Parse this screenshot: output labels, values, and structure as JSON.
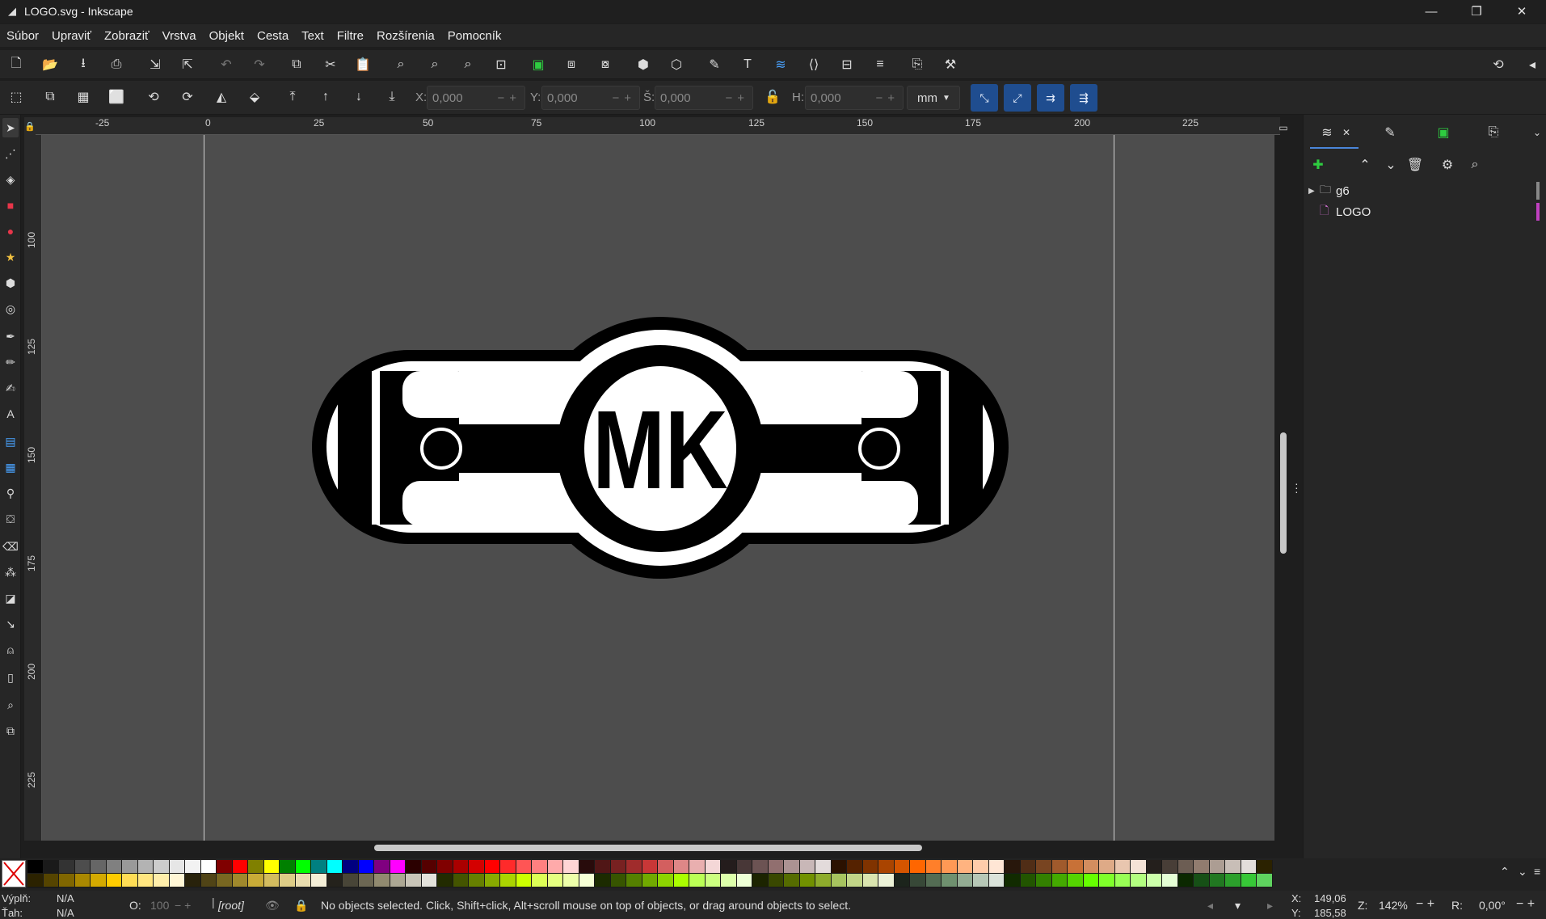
{
  "window": {
    "title": "LOGO.svg - Inkscape",
    "controls": [
      "—",
      "❐",
      "✕"
    ]
  },
  "menu": [
    "Súbor",
    "Upraviť",
    "Zobraziť",
    "Vrstva",
    "Objekt",
    "Cesta",
    "Text",
    "Filtre",
    "Rozšírenia",
    "Pomocník"
  ],
  "controls": {
    "x_label": "X:",
    "x_value": "0,000",
    "y_label": "Y:",
    "y_value": "0,000",
    "w_label": "Š:",
    "w_value": "0,000",
    "h_label": "H:",
    "h_value": "0,000",
    "unit": "mm"
  },
  "rulers": {
    "horizontal": [
      "-25",
      "0",
      "25",
      "50",
      "75",
      "100",
      "125",
      "150",
      "175",
      "200",
      "225"
    ],
    "vertical": [
      "100",
      "125",
      "150",
      "175",
      "200",
      "225"
    ]
  },
  "logo": {
    "text": "MK",
    "colors": {
      "dark": "#000000",
      "light": "#ffffff"
    }
  },
  "layers": {
    "items": [
      {
        "name": "g6",
        "type": "group",
        "color": "#888888"
      },
      {
        "name": "LOGO",
        "type": "layer",
        "color": "#c040c0"
      }
    ]
  },
  "status": {
    "fill_label": "Výplň:",
    "fill_value": "N/A",
    "stroke_label": "Ťah:",
    "stroke_value": "N/A",
    "opacity_label": "O:",
    "opacity_value": "100",
    "layer": "[root]",
    "message": "No objects selected. Click, Shift+click, Alt+scroll mouse on top of objects, or drag around objects to select.",
    "cursor_x_label": "X:",
    "cursor_x": "149,06",
    "cursor_y_label": "Y:",
    "cursor_y": "185,58",
    "zoom_label": "Z:",
    "zoom": "142%",
    "rotation_label": "R:",
    "rotation": "0,00°"
  },
  "palette": {
    "row1": [
      "#000000",
      "#1a1a1a",
      "#333333",
      "#4d4d4d",
      "#666666",
      "#808080",
      "#999999",
      "#b3b3b3",
      "#cccccc",
      "#e6e6e6",
      "#f2f2f2",
      "#ffffff",
      "#800000",
      "#ff0000",
      "#808000",
      "#ffff00",
      "#008000",
      "#00ff00",
      "#008080",
      "#00ffff",
      "#000080",
      "#0000ff",
      "#800080",
      "#ff00ff",
      "#2b0000",
      "#550000",
      "#800000",
      "#aa0000",
      "#d40000",
      "#ff0000",
      "#ff2a2a",
      "#ff5555",
      "#ff8080",
      "#ffaaaa",
      "#ffd5d5",
      "#280b0b",
      "#501616",
      "#782121",
      "#a02c2c",
      "#c83737",
      "#d35f5f",
      "#de8787",
      "#e9afaf",
      "#f4d7d7",
      "#241c1c",
      "#483737",
      "#6c5353",
      "#916f6f",
      "#ac9393",
      "#c8b7b7",
      "#e3dbdb",
      "#2b1100",
      "#552200",
      "#803300",
      "#aa4400",
      "#d45500",
      "#ff6600",
      "#ff7f2a",
      "#ff9955",
      "#ffb380",
      "#ffccaa",
      "#ffe6d5",
      "#28170b",
      "#502d16",
      "#784421",
      "#a05a2c",
      "#c87137",
      "#d38d5f",
      "#deaa87",
      "#e9c6af",
      "#f4e3d7",
      "#241f1c",
      "#483e37",
      "#6c5d53",
      "#917c6f",
      "#ac9d93",
      "#c8beb7",
      "#e3dedb",
      "#2b2200"
    ],
    "row2": [
      "#2b2200",
      "#554400",
      "#806600",
      "#aa8800",
      "#d4aa00",
      "#ffcc00",
      "#ffdd55",
      "#ffe680",
      "#ffeeaa",
      "#fff6d5",
      "#28220b",
      "#504416",
      "#786721",
      "#a0892c",
      "#c8ab37",
      "#d3bc5f",
      "#decd87",
      "#e9ddaf",
      "#f4eed7",
      "#24221c",
      "#484537",
      "#6c6753",
      "#918a6f",
      "#aca793",
      "#c8c4b7",
      "#e3e2db",
      "#222b00",
      "#445500",
      "#668000",
      "#88aa00",
      "#aad400",
      "#ccff00",
      "#ddff55",
      "#e5ff80",
      "#eeffaa",
      "#f6ffd5",
      "#1c2b00",
      "#375500",
      "#558000",
      "#71aa00",
      "#8dd400",
      "#aaff00",
      "#bbff55",
      "#ccff80",
      "#ddffaa",
      "#eeffd5",
      "#1c2400",
      "#394800",
      "#556c00",
      "#719100",
      "#8eac2c",
      "#a7c45f",
      "#c1d587",
      "#dae5af",
      "#ecf2d7",
      "#1c241c",
      "#374837",
      "#536c53",
      "#6f916f",
      "#93ac93",
      "#b7c8b7",
      "#dbe3db",
      "#112b00",
      "#225500",
      "#338000",
      "#44aa00",
      "#55d400",
      "#66ff00",
      "#7fff2a",
      "#99ff55",
      "#b3ff80",
      "#ccffaa",
      "#e5ffd5",
      "#0b2800",
      "#165016",
      "#217821",
      "#2ca02c",
      "#37c837",
      "#5fd35f",
      "#87de87",
      "#afe9af"
    ]
  }
}
